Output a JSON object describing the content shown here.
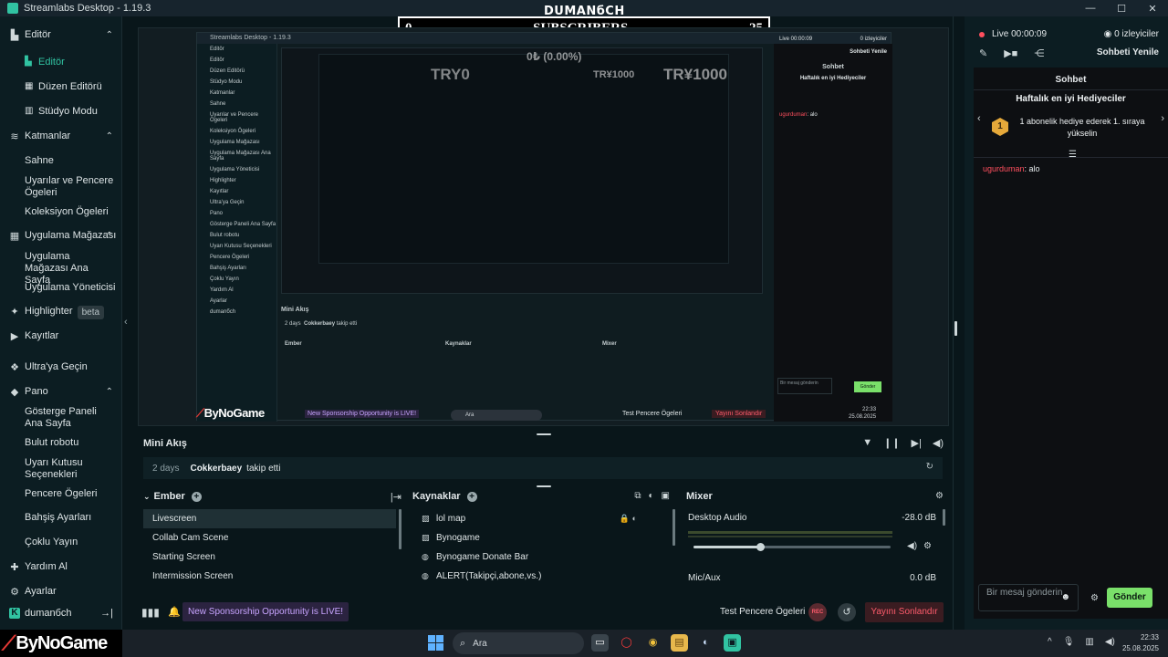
{
  "window": {
    "title": "Streamlabs Desktop - 1.19.3",
    "controls": [
      "—",
      "☐",
      "✕"
    ]
  },
  "sidebar": {
    "items": [
      {
        "label": "Editör",
        "icon": "editor-icon",
        "type": "head",
        "expanded": true
      },
      {
        "label": "Editör",
        "icon": "editor-icon",
        "type": "sub2",
        "active": true
      },
      {
        "label": "Düzen Editörü",
        "icon": "layout-icon",
        "type": "sub2"
      },
      {
        "label": "Stüdyo Modu",
        "icon": "studio-icon",
        "type": "sub2"
      },
      {
        "label": "Katmanlar",
        "icon": "layers-icon",
        "type": "head",
        "expanded": true
      },
      {
        "label": "Sahne",
        "type": "sub"
      },
      {
        "label": "Uyarılar ve Pencere Ögeleri",
        "type": "sub"
      },
      {
        "label": "Koleksiyon Ögeleri",
        "type": "sub"
      },
      {
        "label": "Uygulama Mağazası",
        "icon": "store-icon",
        "type": "head",
        "expanded": true
      },
      {
        "label": "Uygulama Mağazası Ana Sayfa",
        "type": "sub"
      },
      {
        "label": "Uygulama Yöneticisi",
        "type": "sub"
      },
      {
        "label": "Highlighter",
        "icon": "highlighter-icon",
        "type": "head",
        "badge": "beta"
      },
      {
        "label": "Kayıtlar",
        "icon": "recordings-icon",
        "type": "head"
      },
      {
        "label": "Ultra'ya Geçin",
        "icon": "ultra-icon",
        "type": "head"
      },
      {
        "label": "Pano",
        "icon": "dashboard-icon",
        "type": "head",
        "expanded": true
      },
      {
        "label": "Gösterge Paneli Ana Sayfa",
        "type": "sub"
      },
      {
        "label": "Bulut robotu",
        "type": "sub"
      },
      {
        "label": "Uyarı Kutusu Seçenekleri",
        "type": "sub"
      },
      {
        "label": "Pencere Ögeleri",
        "type": "sub"
      },
      {
        "label": "Bahşiş Ayarları",
        "type": "sub"
      },
      {
        "label": "Çoklu Yayın",
        "type": "sub"
      },
      {
        "label": "Yardım Al",
        "icon": "help-icon",
        "type": "head"
      },
      {
        "label": "Ayarlar",
        "icon": "settings-icon",
        "type": "head"
      }
    ],
    "user": "dumanбch"
  },
  "overlay": {
    "brand": "DUMANбCH",
    "subs_left": "0",
    "subs_label": "SUBSCRIBERS",
    "subs_right": "25",
    "donate_ghost": "0₺ (0.00%)",
    "try0": "TRY0",
    "try1000": "TR¥1000",
    "try1000_small": "TR¥1000",
    "bynogame": "ByNoGame"
  },
  "nested": {
    "title": "Streamlabs Desktop - 1.19.3",
    "sidebar": [
      "Editör",
      "Editör",
      "Düzen Editörü",
      "Stüdyo Modu",
      "Katmanlar",
      "Sahne",
      "Uyarılar ve Pencere Ögeleri",
      "Koleksiyon Ögeleri",
      "Uygulama Mağazası",
      "Uygulama Mağazası Ana Sayfa",
      "Uygulama Yöneticisi",
      "Highlighter",
      "Kayıtlar",
      "Ultra'ya Geçin",
      "Pano",
      "Gösterge Paneli Ana Sayfa",
      "Bulut robotu",
      "Uyarı Kutusu Seçenekleri",
      "Pencere Ögeleri",
      "Bahşiş Ayarları",
      "Çoklu Yayın",
      "Yardım Al",
      "Ayarlar",
      "dumanбch"
    ],
    "chat_header": "Sohbet",
    "gift_title": "Haftalık en iyi Hediyeciler",
    "chat_msg_name": "ugurduman",
    "chat_msg_text": ": alo",
    "mini_title": "Mini Akış",
    "mini_time": "2 days",
    "mini_name": "Cokkerbaey",
    "mini_action": "takip etti",
    "scenes_title": "Ember",
    "sources_title": "Kaynaklar",
    "mixer_title": "Mixer",
    "sponsor": "New Sponsorship Opportunity is LIVE!",
    "test": "Test Pencere Ögeleri",
    "end": "Yayını Sonlandır",
    "input_placeholder": "Bir mesaj gönderin",
    "send": "Gönder",
    "live": "Live 00:00:09",
    "viewers": "0 izleyiciler",
    "refresh": "Sohbeti Yenile",
    "clock_time": "22:33",
    "clock_date": "25.08.2025",
    "search": "Ara"
  },
  "mini_feed": {
    "title": "Mini Akış",
    "time": "2 days",
    "name": "Cokkerbaey",
    "action": "takip etti"
  },
  "scenes": {
    "title": "Ember",
    "items": [
      "Livescreen",
      "Collab Cam Scene",
      "Starting Screen",
      "Intermission Screen"
    ],
    "selected": 0
  },
  "sources": {
    "title": "Kaynaklar",
    "items": [
      {
        "label": "lol map",
        "icon": "image-icon"
      },
      {
        "label": "Bynogame",
        "icon": "image-icon"
      },
      {
        "label": "Bynogame Donate Bar",
        "icon": "browser-icon"
      },
      {
        "label": "ALERT(Takipçi,abone,vs.)",
        "icon": "browser-icon"
      }
    ]
  },
  "mixer": {
    "title": "Mixer",
    "desktop_label": "Desktop Audio",
    "desktop_db": "-28.0 dB",
    "desktop_volume": 0.34,
    "mic_label": "Mic/Aux",
    "mic_db": "0.0 dB"
  },
  "footer": {
    "sponsor": "New Sponsorship Opportunity is LIVE!",
    "test": "Test Pencere Ögeleri",
    "rec": "REC",
    "end_stream": "Yayını Sonlandır"
  },
  "chat": {
    "live": "Live 00:00:09",
    "viewers": "0 izleyiciler",
    "refresh": "Sohbeti Yenile",
    "header": "Sohbet",
    "gift_title": "Haftalık en iyi Hediyeciler",
    "gift_rank": "1",
    "gift_text": "1 abonelik hediye ederek 1. sıraya yükselin",
    "msg_name": "ugurduman",
    "msg_text": ": alo",
    "placeholder": "Bir mesaj gönderin",
    "send": "Gönder"
  },
  "taskbar": {
    "search": "Ara",
    "time": "22:33",
    "date": "25.08.2025"
  }
}
